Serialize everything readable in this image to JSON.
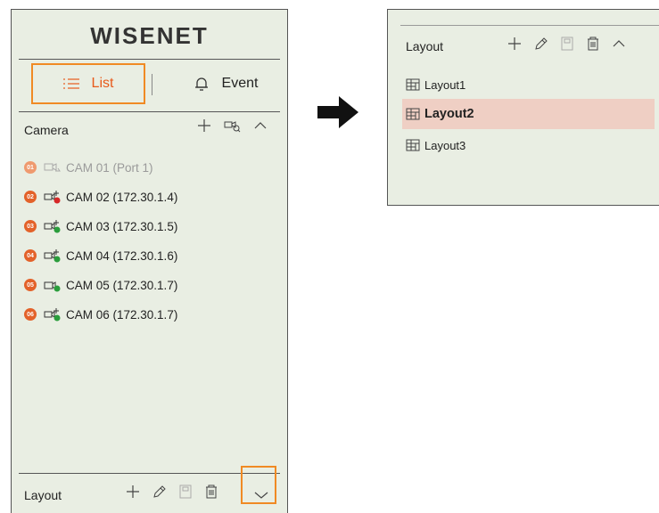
{
  "brand": "WISENET",
  "tabs": [
    {
      "label": "List",
      "icon": "list-icon",
      "active": true
    },
    {
      "label": "Event",
      "icon": "bell-icon",
      "active": false
    }
  ],
  "camera": {
    "title": "Camera",
    "items": [
      {
        "num": "01",
        "label": "CAM 01 (Port 1)",
        "state": "disconnected"
      },
      {
        "num": "02",
        "label": "CAM 02 (172.30.1.4)",
        "state": "recording"
      },
      {
        "num": "03",
        "label": "CAM 03 (172.30.1.5)",
        "state": "connected"
      },
      {
        "num": "04",
        "label": "CAM 04 (172.30.1.6)",
        "state": "connected"
      },
      {
        "num": "05",
        "label": "CAM 05 (172.30.1.7)",
        "state": "connected"
      },
      {
        "num": "06",
        "label": "CAM 06 (172.30.1.7)",
        "state": "connected"
      }
    ]
  },
  "layout": {
    "title": "Layout",
    "items": [
      {
        "label": "Layout1",
        "selected": false
      },
      {
        "label": "Layout2",
        "selected": true
      },
      {
        "label": "Layout3",
        "selected": false
      }
    ]
  },
  "colors": {
    "accent": "#f08a24",
    "badge": "#e3622a",
    "panel_bg": "#e9eee3",
    "selected_bg": "#efcfc4",
    "connected": "#2a9d3c",
    "recording": "#d62828"
  }
}
